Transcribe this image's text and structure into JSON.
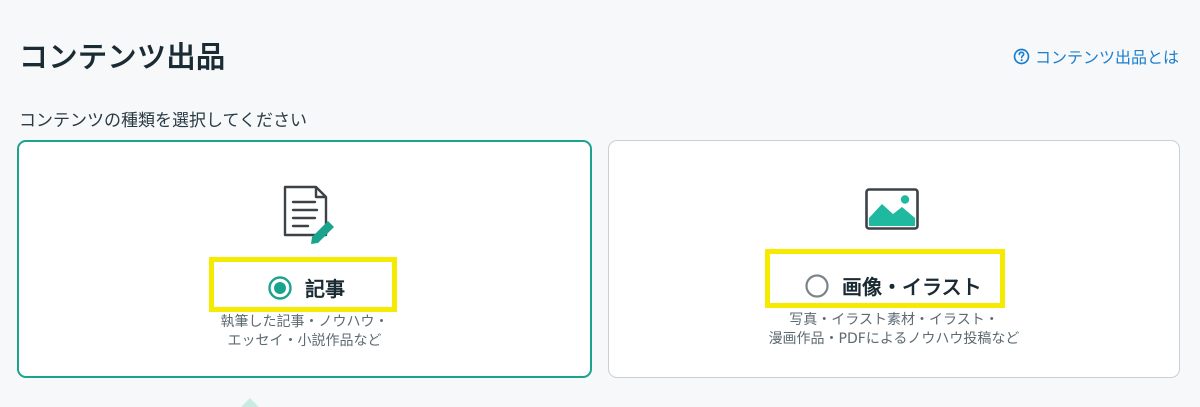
{
  "header": {
    "title": "コンテンツ出品",
    "help_link": "コンテンツ出品とは",
    "help_icon": "question-circle-icon"
  },
  "section": {
    "label": "コンテンツの種類を選択してください"
  },
  "options": [
    {
      "label": "記事",
      "selected": true,
      "icon": "document-edit-icon",
      "desc_line1": "執筆した記事・ノウハウ・",
      "desc_line2": "エッセイ・小説作品など"
    },
    {
      "label": "画像・イラスト",
      "selected": false,
      "icon": "image-icon",
      "desc_line1": "写真・イラスト素材・イラスト・",
      "desc_line2": "漫画作品・PDFによるノウハウ投稿など"
    }
  ],
  "colors": {
    "accent": "#1aa38d",
    "link": "#1a7fcf",
    "highlight": "#f5ea00",
    "unselected_border": "#c9cfd4"
  }
}
